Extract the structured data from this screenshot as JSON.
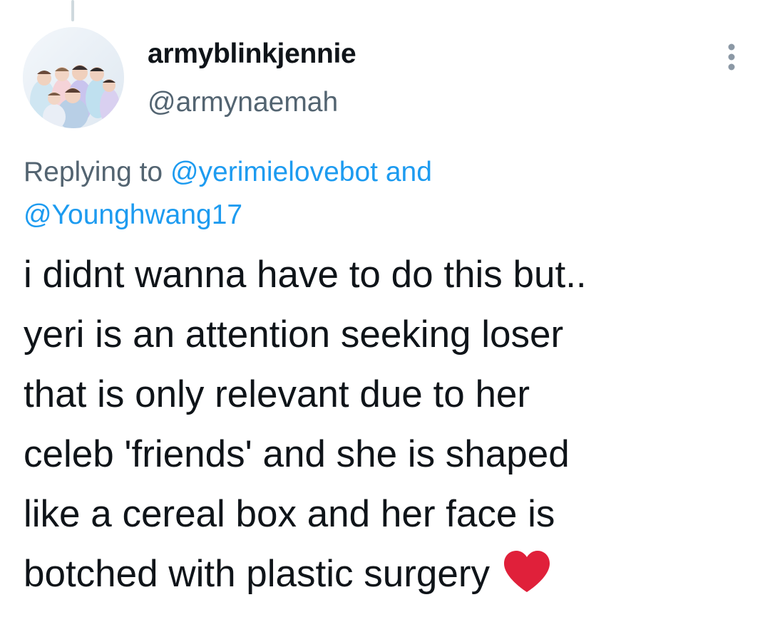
{
  "tweet": {
    "author": {
      "display_name": "armyblinkjennie",
      "handle": "@armynaemah",
      "avatar_icon": "group-photo-avatar"
    },
    "more_icon": "more-vertical-icon",
    "reply_context": {
      "prefix": "Replying to ",
      "mention_1": "@yerimielovebot",
      "joiner": " and",
      "mention_2": "@Younghwang17"
    },
    "text": "i didnt wanna have to do this but..\nyeri is an attention seeking loser\nthat is only relevant due to her\nceleb 'friends' and she is shaped\nlike a cereal box and her face is\nbotched with plastic surgery",
    "emoji": "red-heart-icon"
  },
  "colors": {
    "text_primary": "#0f1419",
    "text_secondary": "#536471",
    "link": "#1d9bf0",
    "heart": "#e0203a"
  }
}
